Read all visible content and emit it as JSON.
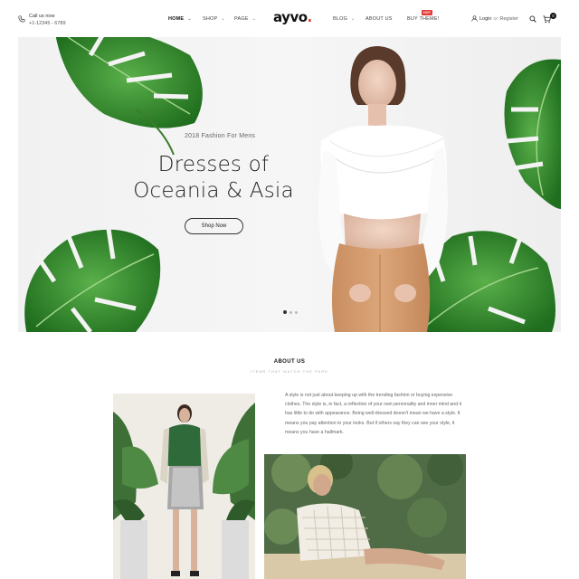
{
  "header": {
    "call_label": "Call us now",
    "call_number": "+1-12345 - 6789",
    "nav_left": [
      {
        "label": "HOME",
        "active": true
      },
      {
        "label": "SHOP",
        "active": false
      },
      {
        "label": "PAGE",
        "active": false
      }
    ],
    "logo": "ayvo",
    "logo_dot": ".",
    "nav_right": [
      {
        "label": "BLOG",
        "active": false
      },
      {
        "label": "ABOUT US",
        "active": false
      },
      {
        "label": "BUY THEME!",
        "active": false
      }
    ],
    "hot_badge": "HOT",
    "login_label": "Login",
    "login_or": "or",
    "register_label": "Register",
    "cart_count": "0"
  },
  "hero": {
    "subtitle": "2018 Fashion For Mens",
    "title_line1": "Dresses of",
    "title_line2": "Oceania & Asia",
    "button_label": "Shop Now",
    "slide_count": 3,
    "active_slide": 1
  },
  "about": {
    "title": "ABOUT US",
    "tagline": "ITEMS THAT MATCH THE PARK",
    "body": "A style is not just about keeping up with the trending fashion or buying expensive clothes. The style is, in fact, a reflection of your own personality and inner mind and it has little to do with appearance. Being well-dressed doesn't mean we have a style. It means you pay attention to your looks. But if others say they can see your style, it means you have a hallmark."
  },
  "colors": {
    "accent": "#e53935",
    "text_dark": "#222222",
    "leaf": "#2f8a2a"
  },
  "icons": [
    "phone-icon",
    "chevron-down-icon",
    "user-icon",
    "search-icon",
    "cart-icon"
  ]
}
